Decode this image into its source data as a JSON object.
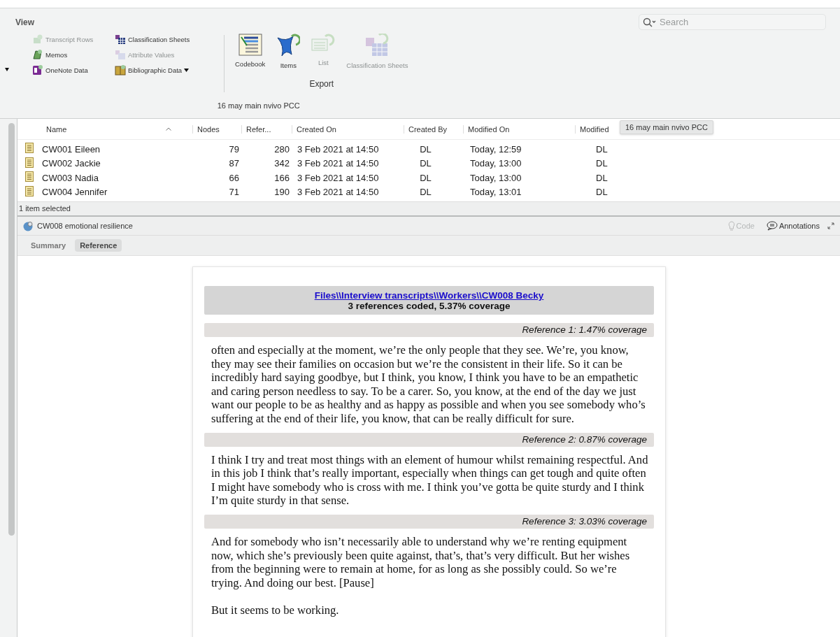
{
  "toolbar": {
    "title": "View",
    "view_items": [
      {
        "label": "Transcript Rows",
        "disabled": true
      },
      {
        "label": "Classification Sheets",
        "disabled": false
      },
      {
        "label": "Memos",
        "disabled": false
      },
      {
        "label": "Attribute Values",
        "disabled": true
      },
      {
        "label": "OneNote Data",
        "disabled": false
      },
      {
        "label": "Bibliographic Data",
        "disabled": false
      }
    ],
    "export_items": [
      {
        "label": "Codebook",
        "disabled": false
      },
      {
        "label": "Items",
        "disabled": false
      },
      {
        "label": "List",
        "disabled": true
      },
      {
        "label": "Classification Sheets",
        "disabled": true
      }
    ],
    "export_title": "Export",
    "project": "16 may main nvivo PCC"
  },
  "search": {
    "placeholder": "Search"
  },
  "table": {
    "columns": [
      "Name",
      "Nodes",
      "Refer...",
      "Created On",
      "Created By",
      "Modified On",
      "Modified"
    ],
    "rows": [
      {
        "name": "CW001 Eileen",
        "nodes": "79",
        "references": "280",
        "created_on": "3 Feb 2021 at 14:50",
        "created_by": "DL",
        "modified_on": "Today, 12:59",
        "modified_by": "DL"
      },
      {
        "name": "CW002 Jackie",
        "nodes": "87",
        "references": "342",
        "created_on": "3 Feb 2021 at 14:50",
        "created_by": "DL",
        "modified_on": "Today, 13:00",
        "modified_by": "DL"
      },
      {
        "name": "CW003 Nadia",
        "nodes": "66",
        "references": "166",
        "created_on": "3 Feb 2021 at 14:50",
        "created_by": "DL",
        "modified_on": "Today, 13:00",
        "modified_by": "DL"
      },
      {
        "name": "CW004  Jennifer",
        "nodes": "71",
        "references": "190",
        "created_on": "3 Feb 2021 at 14:50",
        "created_by": "DL",
        "modified_on": "Today, 13:01",
        "modified_by": "DL"
      }
    ]
  },
  "tooltip": "16 may main nvivo PCC",
  "status": "1 item selected",
  "node": {
    "title": "CW008 emotional resilience"
  },
  "actions": [
    {
      "label": "Code",
      "disabled": true
    },
    {
      "label": "Annotations",
      "disabled": false
    }
  ],
  "tabs": [
    {
      "label": "Summary",
      "selected": false
    },
    {
      "label": "Reference",
      "selected": true
    }
  ],
  "document": {
    "link": "Files\\\\Interview transcripts\\\\Workers\\\\CW008 Becky",
    "summary": "3 references coded, 5.37% coverage",
    "references": [
      {
        "heading": "Reference 1: 1.47% coverage",
        "paragraphs": [
          "often and especially at the moment, we’re the only people that they see. We’re, you know, they may see their families on occasion but we’re the consistent in their life. So it can be incredibly hard saying goodbye, but I think, you know, I think you have to be an empathetic and caring person needless to say. To be a carer. So, you know, at the end of the day we just want our people to be as healthy and as happy as possible and when you see somebody who’s suffering at the end of their life, you know, that can be really difficult for sure."
        ]
      },
      {
        "heading": "Reference 2: 0.87% coverage",
        "paragraphs": [
          "I think I try and treat most things with an element of humour whilst remaining respectful. And in this job I think that’s really important, especially when things can get tough and quite often I might have somebody who is cross with me. I think you’ve gotta be quite sturdy and I think I’m quite sturdy in that sense."
        ]
      },
      {
        "heading": "Reference 3: 3.03% coverage",
        "paragraphs": [
          "And for somebody who isn’t necessarily able to understand why we’re renting equipment now, which she’s previously been quite against, that’s, that’s very difficult. But her wishes from the beginning were to remain at home, for as long as she possibly could. So we’re trying. And doing our best. [Pause]",
          "But it seems to be working."
        ]
      }
    ]
  }
}
